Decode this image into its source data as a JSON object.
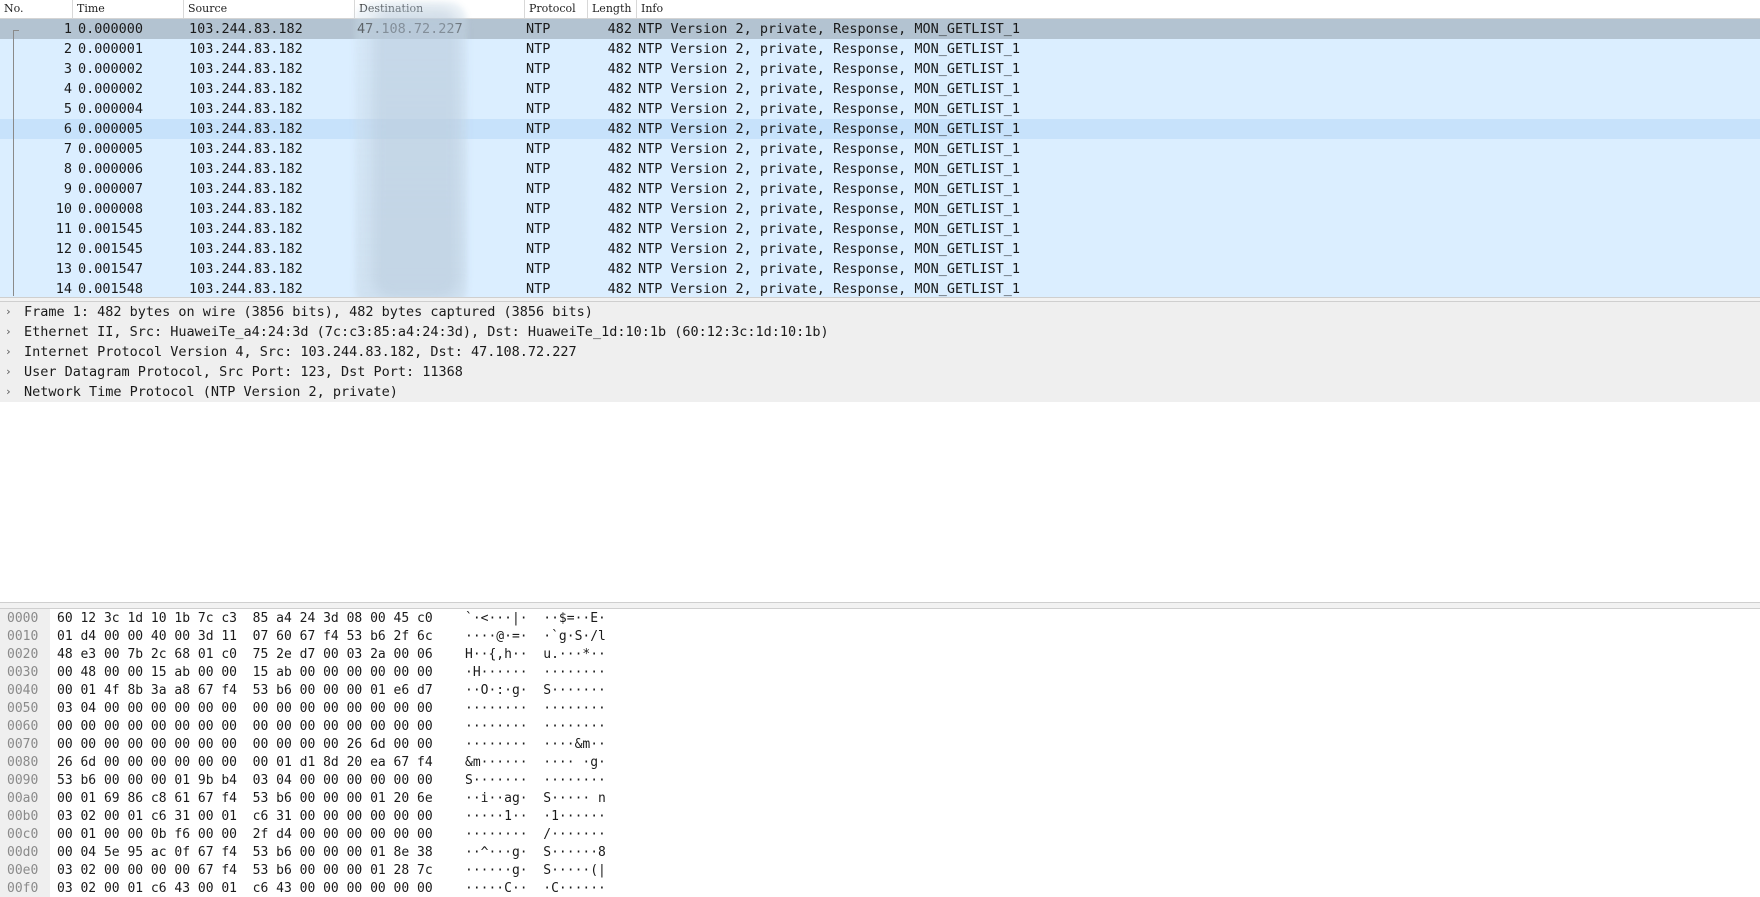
{
  "columns": [
    "No.",
    "Time",
    "Source",
    "Destination",
    "Protocol",
    "Length",
    "Info"
  ],
  "packets": [
    {
      "no": "1",
      "time": "0.000000",
      "src": "103.244.83.182",
      "dst": "47.108.72.227",
      "proto": "NTP",
      "len": "482",
      "info": "NTP Version 2, private, Response, MON_GETLIST_1"
    },
    {
      "no": "2",
      "time": "0.000001",
      "src": "103.244.83.182",
      "dst": "",
      "proto": "NTP",
      "len": "482",
      "info": "NTP Version 2, private, Response, MON_GETLIST_1"
    },
    {
      "no": "3",
      "time": "0.000002",
      "src": "103.244.83.182",
      "dst": "",
      "proto": "NTP",
      "len": "482",
      "info": "NTP Version 2, private, Response, MON_GETLIST_1"
    },
    {
      "no": "4",
      "time": "0.000002",
      "src": "103.244.83.182",
      "dst": "",
      "proto": "NTP",
      "len": "482",
      "info": "NTP Version 2, private, Response, MON_GETLIST_1"
    },
    {
      "no": "5",
      "time": "0.000004",
      "src": "103.244.83.182",
      "dst": "",
      "proto": "NTP",
      "len": "482",
      "info": "NTP Version 2, private, Response, MON_GETLIST_1"
    },
    {
      "no": "6",
      "time": "0.000005",
      "src": "103.244.83.182",
      "dst": "",
      "proto": "NTP",
      "len": "482",
      "info": "NTP Version 2, private, Response, MON_GETLIST_1"
    },
    {
      "no": "7",
      "time": "0.000005",
      "src": "103.244.83.182",
      "dst": "",
      "proto": "NTP",
      "len": "482",
      "info": "NTP Version 2, private, Response, MON_GETLIST_1"
    },
    {
      "no": "8",
      "time": "0.000006",
      "src": "103.244.83.182",
      "dst": "",
      "proto": "NTP",
      "len": "482",
      "info": "NTP Version 2, private, Response, MON_GETLIST_1"
    },
    {
      "no": "9",
      "time": "0.000007",
      "src": "103.244.83.182",
      "dst": "",
      "proto": "NTP",
      "len": "482",
      "info": "NTP Version 2, private, Response, MON_GETLIST_1"
    },
    {
      "no": "10",
      "time": "0.000008",
      "src": "103.244.83.182",
      "dst": "",
      "proto": "NTP",
      "len": "482",
      "info": "NTP Version 2, private, Response, MON_GETLIST_1"
    },
    {
      "no": "11",
      "time": "0.001545",
      "src": "103.244.83.182",
      "dst": "",
      "proto": "NTP",
      "len": "482",
      "info": "NTP Version 2, private, Response, MON_GETLIST_1"
    },
    {
      "no": "12",
      "time": "0.001545",
      "src": "103.244.83.182",
      "dst": "",
      "proto": "NTP",
      "len": "482",
      "info": "NTP Version 2, private, Response, MON_GETLIST_1"
    },
    {
      "no": "13",
      "time": "0.001547",
      "src": "103.244.83.182",
      "dst": "",
      "proto": "NTP",
      "len": "482",
      "info": "NTP Version 2, private, Response, MON_GETLIST_1"
    },
    {
      "no": "14",
      "time": "0.001548",
      "src": "103.244.83.182",
      "dst": "",
      "proto": "NTP",
      "len": "482",
      "info": "NTP Version 2, private, Response, MON_GETLIST_1"
    }
  ],
  "details": [
    "Frame 1: 482 bytes on wire (3856 bits), 482 bytes captured (3856 bits)",
    "Ethernet II, Src: HuaweiTe_a4:24:3d (7c:c3:85:a4:24:3d), Dst: HuaweiTe_1d:10:1b (60:12:3c:1d:10:1b)",
    "Internet Protocol Version 4, Src: 103.244.83.182, Dst: 47.108.72.227",
    "User Datagram Protocol, Src Port: 123, Dst Port: 11368",
    "Network Time Protocol (NTP Version 2, private)"
  ],
  "hex": [
    {
      "off": "0000",
      "bytes": "60 12 3c 1d 10 1b 7c c3  85 a4 24 3d 08 00 45 c0",
      "ascii": "`·<···|·  ··$=··E·"
    },
    {
      "off": "0010",
      "bytes": "01 d4 00 00 40 00 3d 11  07 60 67 f4 53 b6 2f 6c",
      "ascii": "····@·=·  ·`g·S·/l"
    },
    {
      "off": "0020",
      "bytes": "48 e3 00 7b 2c 68 01 c0  75 2e d7 00 03 2a 00 06",
      "ascii": "H··{,h··  u.···*··"
    },
    {
      "off": "0030",
      "bytes": "00 48 00 00 15 ab 00 00  15 ab 00 00 00 00 00 00",
      "ascii": "·H······  ········"
    },
    {
      "off": "0040",
      "bytes": "00 01 4f 8b 3a a8 67 f4  53 b6 00 00 00 01 e6 d7",
      "ascii": "··O·:·g·  S·······"
    },
    {
      "off": "0050",
      "bytes": "03 04 00 00 00 00 00 00  00 00 00 00 00 00 00 00",
      "ascii": "········  ········"
    },
    {
      "off": "0060",
      "bytes": "00 00 00 00 00 00 00 00  00 00 00 00 00 00 00 00",
      "ascii": "········  ········"
    },
    {
      "off": "0070",
      "bytes": "00 00 00 00 00 00 00 00  00 00 00 00 26 6d 00 00",
      "ascii": "········  ····&m··"
    },
    {
      "off": "0080",
      "bytes": "26 6d 00 00 00 00 00 00  00 01 d1 8d 20 ea 67 f4",
      "ascii": "&m······  ···· ·g·"
    },
    {
      "off": "0090",
      "bytes": "53 b6 00 00 00 01 9b b4  03 04 00 00 00 00 00 00",
      "ascii": "S·······  ········"
    },
    {
      "off": "00a0",
      "bytes": "00 01 69 86 c8 61 67 f4  53 b6 00 00 00 01 20 6e",
      "ascii": "··i··ag·  S····· n"
    },
    {
      "off": "00b0",
      "bytes": "03 02 00 01 c6 31 00 01  c6 31 00 00 00 00 00 00",
      "ascii": "·····1··  ·1······"
    },
    {
      "off": "00c0",
      "bytes": "00 01 00 00 0b f6 00 00  2f d4 00 00 00 00 00 00",
      "ascii": "········  /·······"
    },
    {
      "off": "00d0",
      "bytes": "00 04 5e 95 ac 0f 67 f4  53 b6 00 00 00 01 8e 38",
      "ascii": "··^···g·  S······8"
    },
    {
      "off": "00e0",
      "bytes": "03 02 00 00 00 00 67 f4  53 b6 00 00 00 01 28 7c",
      "ascii": "······g·  S·····(|"
    },
    {
      "off": "00f0",
      "bytes": "03 02 00 01 c6 43 00 01  c6 43 00 00 00 00 00 00",
      "ascii": "·····C··  ·C······"
    }
  ],
  "icons": {
    "expand": "chevron-right-icon"
  }
}
